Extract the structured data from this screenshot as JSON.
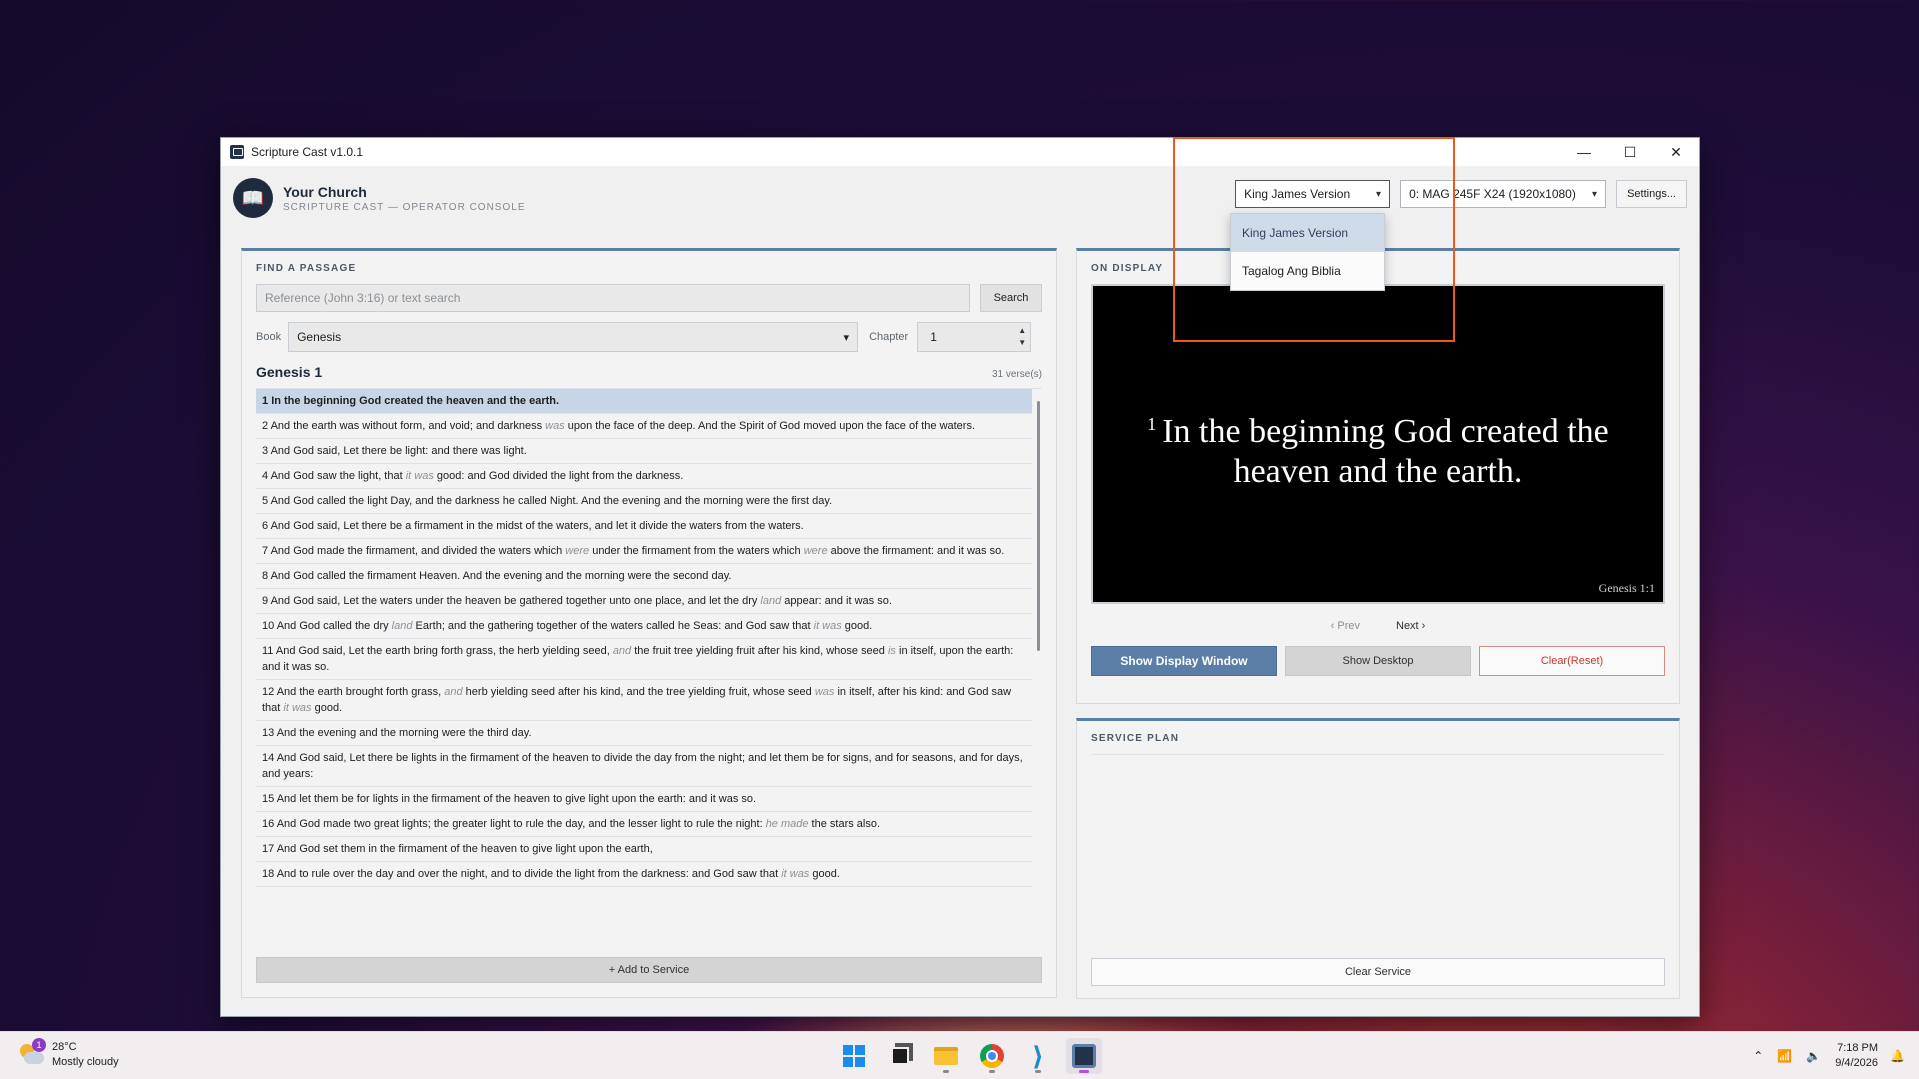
{
  "window": {
    "title": "Scripture Cast v1.0.1",
    "controls": [
      "—",
      "☐",
      "✕"
    ]
  },
  "header": {
    "church_name": "Your Church",
    "subtitle": "SCRIPTURE CAST — OPERATOR CONSOLE",
    "version_select": "King James Version",
    "display_select": "0: MAG 245F X24 (1920x1080)",
    "settings_label": "Settings..."
  },
  "version_dropdown": {
    "options": [
      "King James Version",
      "Tagalog Ang Biblia"
    ],
    "selected_index": 0
  },
  "find": {
    "title": "FIND A PASSAGE",
    "search_placeholder": "Reference (John 3:16) or text search",
    "search_button": "Search",
    "book_label": "Book",
    "book_value": "Genesis",
    "chapter_label": "Chapter",
    "chapter_value": "1",
    "passage_title": "Genesis 1",
    "verse_count": "31 verse(s)",
    "add_button": "+ Add to Service"
  },
  "verses": [
    {
      "n": "1",
      "parts": [
        [
          "In the beginning God created the heaven and the earth.",
          false
        ]
      ]
    },
    {
      "n": "2",
      "parts": [
        [
          "And the earth was without form, and void; and darkness ",
          false
        ],
        [
          "was",
          true
        ],
        [
          " upon the face of the deep. And the Spirit of God moved upon the face of the waters.",
          false
        ]
      ]
    },
    {
      "n": "3",
      "parts": [
        [
          "And God said, Let there be light: and there was light.",
          false
        ]
      ]
    },
    {
      "n": "4",
      "parts": [
        [
          "And God saw the light, that ",
          false
        ],
        [
          "it was",
          true
        ],
        [
          " good: and God divided the light from the darkness.",
          false
        ]
      ]
    },
    {
      "n": "5",
      "parts": [
        [
          "And God called the light Day, and the darkness he called Night. And the evening and the morning were the first day.",
          false
        ]
      ]
    },
    {
      "n": "6",
      "parts": [
        [
          "And God said, Let there be a firmament in the midst of the waters, and let it divide the waters from the waters.",
          false
        ]
      ]
    },
    {
      "n": "7",
      "parts": [
        [
          "And God made the firmament, and divided the waters which ",
          false
        ],
        [
          "were",
          true
        ],
        [
          " under the firmament from the waters which ",
          false
        ],
        [
          "were",
          true
        ],
        [
          " above the firmament: and it was so.",
          false
        ]
      ]
    },
    {
      "n": "8",
      "parts": [
        [
          "And God called the firmament Heaven. And the evening and the morning were the second day.",
          false
        ]
      ]
    },
    {
      "n": "9",
      "parts": [
        [
          "And God said, Let the waters under the heaven be gathered together unto one place, and let the dry ",
          false
        ],
        [
          "land",
          true
        ],
        [
          " appear: and it was so.",
          false
        ]
      ]
    },
    {
      "n": "10",
      "parts": [
        [
          "And God called the dry ",
          false
        ],
        [
          "land",
          true
        ],
        [
          " Earth; and the gathering together of the waters called he Seas: and God saw that ",
          false
        ],
        [
          "it was",
          true
        ],
        [
          " good.",
          false
        ]
      ]
    },
    {
      "n": "11",
      "parts": [
        [
          "And God said, Let the earth bring forth grass, the herb yielding seed, ",
          false
        ],
        [
          "and",
          true
        ],
        [
          " the fruit tree yielding fruit after his kind, whose seed ",
          false
        ],
        [
          "is",
          true
        ],
        [
          " in itself, upon the earth: and it was so.",
          false
        ]
      ]
    },
    {
      "n": "12",
      "parts": [
        [
          "And the earth brought forth grass, ",
          false
        ],
        [
          "and",
          true
        ],
        [
          " herb yielding seed after his kind, and the tree yielding fruit, whose seed ",
          false
        ],
        [
          "was",
          true
        ],
        [
          " in itself, after his kind: and God saw that ",
          false
        ],
        [
          "it was",
          true
        ],
        [
          " good.",
          false
        ]
      ]
    },
    {
      "n": "13",
      "parts": [
        [
          "And the evening and the morning were the third day.",
          false
        ]
      ]
    },
    {
      "n": "14",
      "parts": [
        [
          "And God said, Let there be lights in the firmament of the heaven to divide the day from the night; and let them be for signs, and for seasons, and for days, and years:",
          false
        ]
      ]
    },
    {
      "n": "15",
      "parts": [
        [
          "And let them be for lights in the firmament of the heaven to give light upon the earth: and it was so.",
          false
        ]
      ]
    },
    {
      "n": "16",
      "parts": [
        [
          "And God made two great lights; the greater light to rule the day, and the lesser light to rule the night: ",
          false
        ],
        [
          "he made",
          true
        ],
        [
          " the stars also.",
          false
        ]
      ]
    },
    {
      "n": "17",
      "parts": [
        [
          "And God set them in the firmament of the heaven to give light upon the earth,",
          false
        ]
      ]
    },
    {
      "n": "18",
      "parts": [
        [
          "And to rule over the day and over the night, and to divide the light from the darkness: and God saw that ",
          false
        ],
        [
          "it was",
          true
        ],
        [
          " good.",
          false
        ]
      ]
    }
  ],
  "display": {
    "title": "ON DISPLAY",
    "verse_num": "1",
    "verse_text": "In the beginning God created the heaven and the earth.",
    "reference": "Genesis 1:1",
    "prev_label": "Prev",
    "next_label": "Next",
    "show_button": "Show Display Window",
    "desktop_button": "Show Desktop",
    "clear_button": "Clear(Reset)"
  },
  "service": {
    "title": "SERVICE PLAN",
    "clear_button": "Clear Service"
  },
  "taskbar": {
    "weather_temp": "28°C",
    "weather_desc": "Mostly cloudy",
    "weather_badge": "1",
    "time": "7:18 PM",
    "date": "9/4/2026"
  }
}
